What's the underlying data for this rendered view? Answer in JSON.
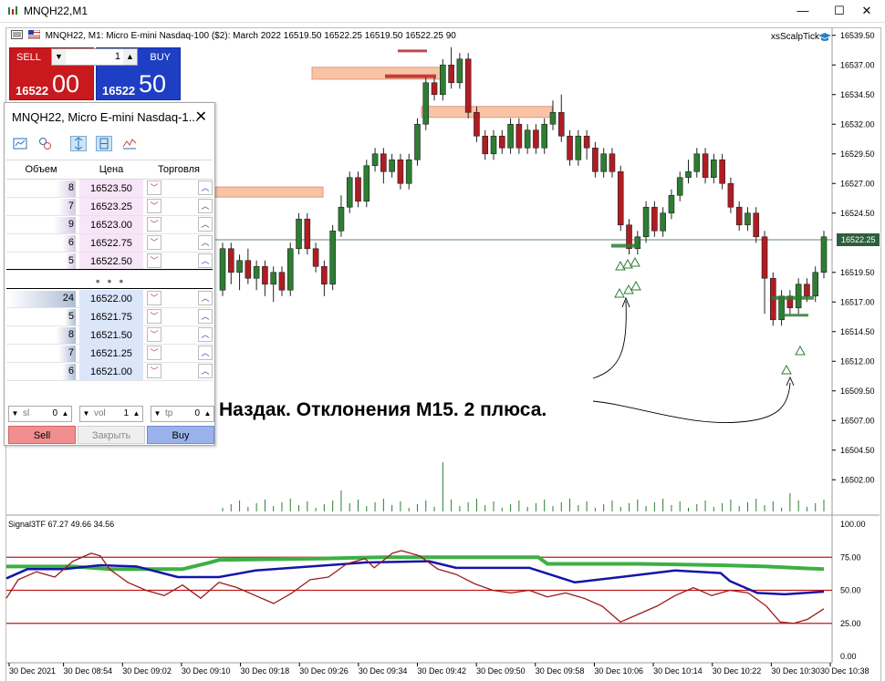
{
  "window": {
    "title": "MNQH22,M1",
    "controls": {
      "minimize": "—",
      "maximize": "☐",
      "close": "✕"
    }
  },
  "chart": {
    "header": {
      "symbol_tf": "MNQH22, M1:",
      "description": "Micro E-mini Nasdaq-100 ($2): March 2022",
      "ohlc": "16519.50 16522.25 16519.50 16522.25",
      "ticks": "90"
    },
    "expert_label": "xsScalpTick",
    "current_price": "16522.25"
  },
  "one_click": {
    "sell_label": "SELL",
    "buy_label": "BUY",
    "lot": "1",
    "sell_small": "16522",
    "sell_big": "00",
    "buy_small": "16522",
    "buy_big": "50"
  },
  "dom": {
    "title": "MNQH22, Micro E-mini Nasdaq-1...",
    "close": "✕",
    "headers": {
      "volume": "Объем",
      "price": "Цена",
      "trade": "Торговля"
    },
    "asks": [
      {
        "volume": "8",
        "price": "16523.50",
        "depth": 0.3
      },
      {
        "volume": "7",
        "price": "16523.25",
        "depth": 0.25
      },
      {
        "volume": "9",
        "price": "16523.00",
        "depth": 0.34
      },
      {
        "volume": "6",
        "price": "16522.75",
        "depth": 0.2
      },
      {
        "volume": "5",
        "price": "16522.50",
        "depth": 0.16
      }
    ],
    "dots": "• • •",
    "bids": [
      {
        "volume": "24",
        "price": "16522.00",
        "depth": 1.0
      },
      {
        "volume": "5",
        "price": "16521.75",
        "depth": 0.16
      },
      {
        "volume": "8",
        "price": "16521.50",
        "depth": 0.3
      },
      {
        "volume": "7",
        "price": "16521.25",
        "depth": 0.25
      },
      {
        "volume": "6",
        "price": "16521.00",
        "depth": 0.2
      }
    ],
    "controls": {
      "sl_label": "sl",
      "sl_value": "0",
      "vol_label": "vol",
      "vol_value": "1",
      "tp_label": "tp",
      "tp_value": "0"
    },
    "actions": {
      "sell": "Sell",
      "close": "Закрыть",
      "buy": "Buy"
    }
  },
  "annotation": "Наздак. Отклонения М15. 2 плюса.",
  "indicator": {
    "title": "Signal3TF 67.27 49.66 34.56",
    "levels": [
      75,
      50,
      25
    ],
    "axis_labels": [
      "100.00",
      "75.00",
      "50.00",
      "25.00",
      "0.00"
    ]
  },
  "price_axis": [
    "16539.50",
    "16537.00",
    "16534.50",
    "16532.00",
    "16529.50",
    "16527.00",
    "16524.50",
    "16522.25",
    "16519.50",
    "16517.00",
    "16514.50",
    "16512.00",
    "16509.50",
    "16507.00",
    "16504.50",
    "16502.00"
  ],
  "time_axis": [
    "30 Dec 2021",
    "30 Dec 08:54",
    "30 Dec 09:02",
    "30 Dec 09:10",
    "30 Dec 09:18",
    "30 Dec 09:26",
    "30 Dec 09:34",
    "30 Dec 09:42",
    "30 Dec 09:50",
    "30 Dec 09:58",
    "30 Dec 10:06",
    "30 Dec 10:14",
    "30 Dec 10:22",
    "30 Dec 10:30",
    "30 Dec 10:38"
  ],
  "colors": {
    "bull": "#2d7d32",
    "bear": "#b01c22",
    "zone": "#f9c3a6",
    "level_line": "#2e5e3e",
    "ind_green": "#3cb043",
    "ind_blue": "#1515a8",
    "ind_red": "#9b1b1b",
    "ind_level": "#c01818"
  }
}
